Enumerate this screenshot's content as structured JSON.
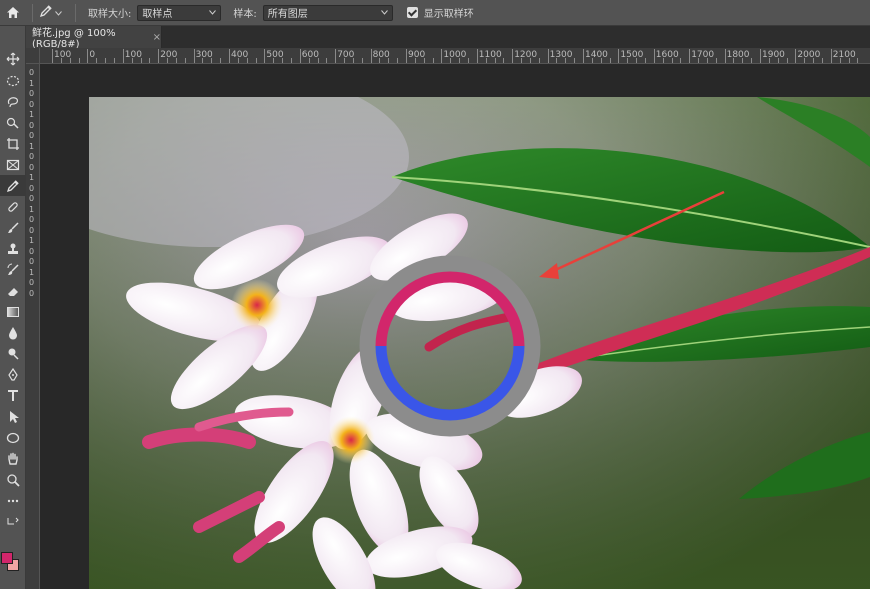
{
  "options_bar": {
    "sample_size_label": "取样大小:",
    "sample_size_value": "取样点",
    "sample_label": "样本:",
    "sample_value": "所有图层",
    "show_ring_label": "显示取样环"
  },
  "document_tab": {
    "title": "鲜花.jpg @ 100%(RGB/8#)",
    "close": "×"
  },
  "ruler_h": {
    "labels": [
      "100",
      "0",
      "100",
      "200",
      "300",
      "400",
      "500",
      "600",
      "700",
      "800",
      "900",
      "1000",
      "1100",
      "1200",
      "1300",
      "1400",
      "1500",
      "1600",
      "1700",
      "1800",
      "1900",
      "2000",
      "2100"
    ]
  },
  "ruler_v": {
    "labels": [
      "0",
      "1",
      "0",
      "0",
      "1",
      "0",
      "0",
      "1",
      "0",
      "0",
      "1",
      "0",
      "0",
      "1",
      "0",
      "0",
      "1",
      "0",
      "0",
      "1",
      "0",
      "0"
    ]
  },
  "colors": {
    "foreground": "#d2266b",
    "background": "#f2a5a5",
    "sampling_ring_top": "#d2266b",
    "sampling_ring_bottom": "#3a56e8",
    "annotation_arrow": "#e8403a"
  },
  "icons": [
    "home-icon",
    "eyedropper-icon",
    "move-icon",
    "marquee-icon",
    "lasso-icon",
    "quick-select-icon",
    "crop-icon",
    "frame-icon",
    "eyedropper-tool-icon",
    "healing-icon",
    "brush-icon",
    "stamp-icon",
    "history-brush-icon",
    "eraser-icon",
    "gradient-icon",
    "blur-icon",
    "dodge-icon",
    "pen-icon",
    "type-icon",
    "path-select-icon",
    "shape-icon",
    "hand-icon",
    "zoom-icon",
    "more-icon"
  ]
}
